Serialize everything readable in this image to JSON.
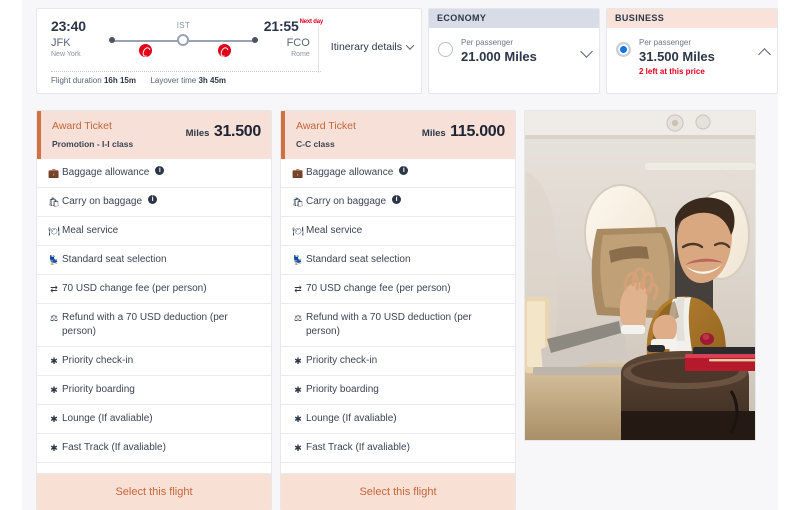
{
  "flight": {
    "depart": {
      "time": "23:40",
      "code": "JFK",
      "city": "New York"
    },
    "arrive": {
      "time": "21:55",
      "next_day": "Next day",
      "code": "FCO",
      "city": "Rome"
    },
    "stop_label": "IST",
    "itinerary_link": "Itinerary details",
    "duration_label": "Flight duration",
    "duration_value": "16h 15m",
    "layover_label": "Layover time",
    "layover_value": "3h 45m"
  },
  "fares": [
    {
      "cabin": "ECONOMY",
      "per_passenger": "Per passenger",
      "price": "21.000 Miles",
      "selected": false,
      "note": "",
      "chevron": "chevron-down-icon"
    },
    {
      "cabin": "BUSINESS",
      "per_passenger": "Per passenger",
      "price": "31.500 Miles",
      "selected": true,
      "note": "2 left at this price",
      "chevron": "chevron-up-icon"
    }
  ],
  "tickets": [
    {
      "title": "Award Ticket",
      "subtitle": "Promotion - I-I class",
      "miles_label": "Miles",
      "miles_value": "31.500",
      "cta": "Select this flight",
      "features": [
        {
          "icon": "baggage-icon",
          "text": "Baggage allowance",
          "info": true
        },
        {
          "icon": "carryon-icon",
          "text": "Carry on baggage",
          "info": true
        },
        {
          "icon": "meal-icon",
          "text": "Meal service",
          "info": false
        },
        {
          "icon": "seat-icon",
          "text": "Standard seat selection",
          "info": false
        },
        {
          "icon": "change-fee-icon",
          "text": "70 USD change fee (per person)",
          "info": false
        },
        {
          "icon": "refund-icon",
          "text": "Refund with a 70 USD deduction (per person)",
          "info": false
        },
        {
          "icon": "star-icon",
          "text": "Priority check-in",
          "info": false
        },
        {
          "icon": "star-icon",
          "text": "Priority boarding",
          "info": false
        },
        {
          "icon": "star-icon",
          "text": "Lounge (If avaliable)",
          "info": false
        },
        {
          "icon": "star-icon",
          "text": "Fast Track (If avaliable)",
          "info": false
        }
      ]
    },
    {
      "title": "Award Ticket",
      "subtitle": "C-C class",
      "miles_label": "Miles",
      "miles_value": "115.000",
      "cta": "Select this flight",
      "features": [
        {
          "icon": "baggage-icon",
          "text": "Baggage allowance",
          "info": true
        },
        {
          "icon": "carryon-icon",
          "text": "Carry on baggage",
          "info": true
        },
        {
          "icon": "meal-icon",
          "text": "Meal service",
          "info": false
        },
        {
          "icon": "seat-icon",
          "text": "Standard seat selection",
          "info": false
        },
        {
          "icon": "change-fee-icon",
          "text": "70 USD change fee (per person)",
          "info": false
        },
        {
          "icon": "refund-icon",
          "text": "Refund with a 70 USD deduction (per person)",
          "info": false
        },
        {
          "icon": "star-icon",
          "text": "Priority check-in",
          "info": false
        },
        {
          "icon": "star-icon",
          "text": "Priority boarding",
          "info": false
        },
        {
          "icon": "star-icon",
          "text": "Lounge (If avaliable)",
          "info": false
        },
        {
          "icon": "star-icon",
          "text": "Fast Track (If avaliable)",
          "info": false
        }
      ]
    }
  ],
  "photo": {
    "alt": "business-class-cabin-passenger"
  },
  "colors": {
    "accent_orange": "#c4663a",
    "header_peach": "#f6e0d7",
    "header_grey": "#d8dce6",
    "radio_blue": "#1573e6",
    "alert_red": "#e3001b"
  }
}
